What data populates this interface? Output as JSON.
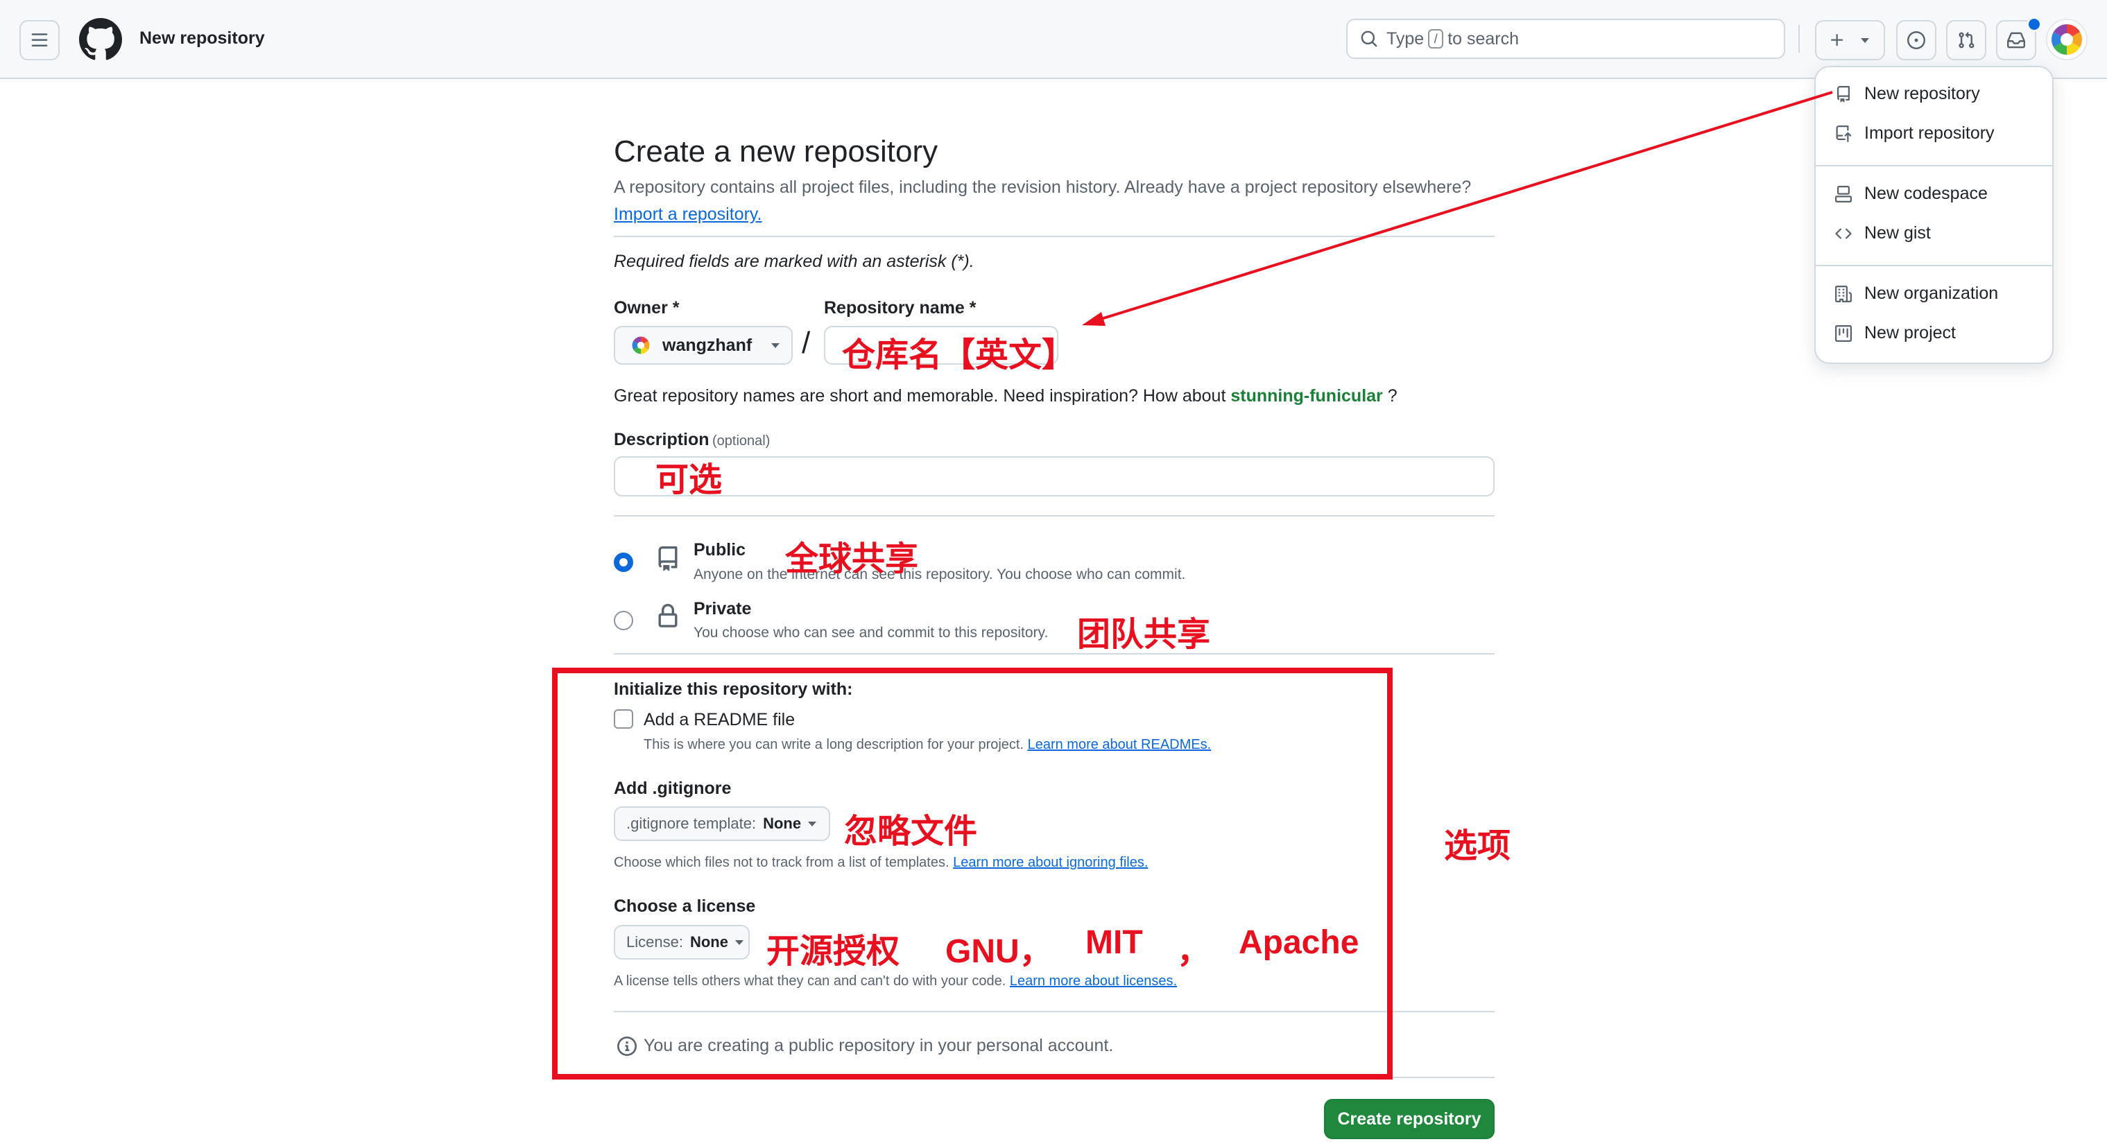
{
  "header": {
    "title": "New repository",
    "search_text_before": "Type",
    "search_key": "/",
    "search_text_after": "to search",
    "plus_label": "+"
  },
  "dropdown": {
    "items": [
      {
        "label": "New repository",
        "icon": "repo-icon"
      },
      {
        "label": "Import repository",
        "icon": "repo-push-icon"
      },
      {
        "label": "New codespace",
        "icon": "codespaces-icon"
      },
      {
        "label": "New gist",
        "icon": "code-icon"
      },
      {
        "label": "New organization",
        "icon": "organization-icon"
      },
      {
        "label": "New project",
        "icon": "project-icon"
      }
    ]
  },
  "form": {
    "title": "Create a new repository",
    "subtitle": "A repository contains all project files, including the revision history. Already have a project repository elsewhere?",
    "import_link": "Import a repository.",
    "required_note": "Required fields are marked with an asterisk (*).",
    "owner_label": "Owner *",
    "owner_value": "wangzhanf",
    "slash": "/",
    "repo_name_label": "Repository name *",
    "inspiration_text": "Great repository names are short and memorable. Need inspiration? How about",
    "inspiration_suggestion": "stunning-funicular",
    "inspiration_end": "?",
    "description_label": "Description",
    "description_optional": "(optional)",
    "public_title": "Public",
    "public_desc": "Anyone on the internet can see this repository. You choose who can commit.",
    "private_title": "Private",
    "private_desc": "You choose who can see and commit to this repository.",
    "init_label": "Initialize this repository with:",
    "readme_label": "Add a README file",
    "readme_desc": "This is where you can write a long description for your project.",
    "readme_link": "Learn more about READMEs.",
    "gitignore_label": "Add .gitignore",
    "gitignore_select_prefix": ".gitignore template:",
    "gitignore_select_value": "None",
    "gitignore_desc": "Choose which files not to track from a list of templates.",
    "gitignore_link": "Learn more about ignoring files.",
    "license_label": "Choose a license",
    "license_select_prefix": "License:",
    "license_select_value": "None",
    "license_desc": "A license tells others what they can and can't do with your code.",
    "license_link": "Learn more about licenses.",
    "info_note": "You are creating a public repository in your personal account.",
    "create_button": "Create repository"
  },
  "annotations": {
    "repo_name": "仓库名【英文】",
    "description": "可选",
    "public": "全球共享",
    "private": "团队共享",
    "gitignore": "忽略文件",
    "license_prefix": "开源授权",
    "license_gnu": "GNU，",
    "license_mit": "MIT",
    "license_comma": "，",
    "license_apache": "Apache",
    "options": "选项",
    "color": "#e8101f"
  },
  "colors": {
    "primary_button": "#1f883d",
    "link": "#0969da",
    "suggestion": "#1a7f37"
  }
}
